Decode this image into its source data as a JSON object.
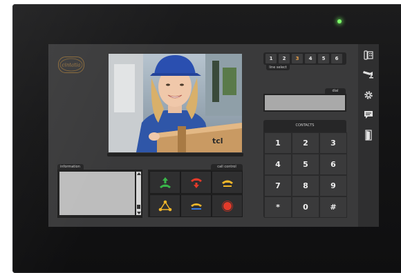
{
  "device": {
    "logo_text": "cintatia",
    "led_color": "#7dff6a"
  },
  "line_select": {
    "label": "line select",
    "lines": [
      "1",
      "2",
      "3",
      "4",
      "5",
      "6"
    ],
    "active_index": 2,
    "active_color": "#e8a04a"
  },
  "information": {
    "label": "information"
  },
  "call_control": {
    "label": "call control",
    "buttons": [
      {
        "name": "answer",
        "icon": "phone-up-icon",
        "color": "#3ab54a"
      },
      {
        "name": "hang-up",
        "icon": "phone-down-icon",
        "color": "#e23a2a"
      },
      {
        "name": "hold",
        "icon": "phone-hold-icon",
        "color": "#f0b62a"
      },
      {
        "name": "conference",
        "icon": "conference-icon",
        "color": "#f0b62a"
      },
      {
        "name": "transfer",
        "icon": "transfer-icon",
        "color": "#f0b62a"
      },
      {
        "name": "record",
        "icon": "record-icon",
        "color": "#e23a2a"
      }
    ]
  },
  "dial": {
    "label": "dial"
  },
  "keypad": {
    "label": "CONTACTS",
    "keys": [
      "1",
      "2",
      "3",
      "4",
      "5",
      "6",
      "7",
      "8",
      "9",
      "*",
      "0",
      "#"
    ]
  },
  "video": {
    "overlay_text": "tcl"
  },
  "sidebar": {
    "icons": [
      "intercom-icon",
      "cctv-camera-icon",
      "settings-gear-icon",
      "message-icon",
      "door-icon"
    ]
  }
}
